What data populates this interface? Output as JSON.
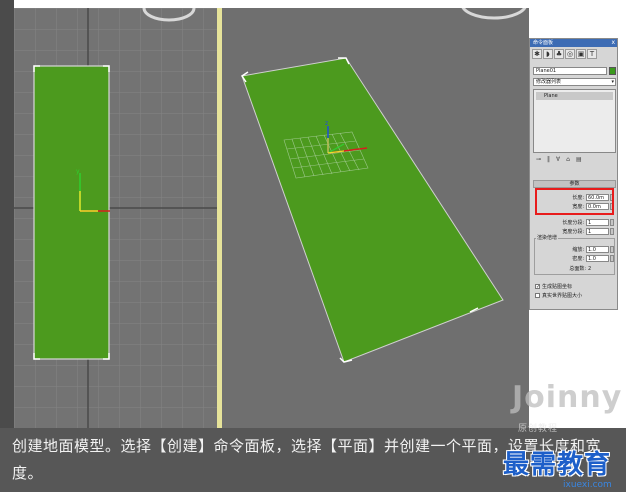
{
  "caption": {
    "text": "创建地面模型。选择【创建】命令面板，选择【平面】并创建一个平面，设置长度和宽度。"
  },
  "command_panel": {
    "title": "命令面板",
    "close_glyph": "x",
    "tabs": [
      "create-icon",
      "modify-icon",
      "hierarchy-icon",
      "motion-icon",
      "display-icon",
      "utilities-icon"
    ],
    "object_name": "Plane01",
    "modifier_list": "修改器列表",
    "stack_item": "Plane",
    "params_title": "参数",
    "length_label": "长度:",
    "length_value": "60.0m",
    "width_label": "宽度:",
    "width_value": "0.0m",
    "length_segs_label": "长度分段:",
    "length_segs_value": "1",
    "width_segs_label": "宽度分段:",
    "width_segs_value": "1",
    "render_group_label": "渲染倍增",
    "scale_label": "缩放:",
    "scale_value": "1.0",
    "density_label": "密度:",
    "density_value": "1.0",
    "total_faces_label": "总面数:",
    "total_faces_value": "2",
    "gen_map_label": "生成贴图坐标",
    "real_world_label": "真实世界贴图大小",
    "gen_map_checked": true,
    "real_world_checked": false
  },
  "watermarks": {
    "jointy": "Joinny",
    "sub": "原创教程",
    "brand": "最需教育",
    "site": "ixuexi.com"
  },
  "colors": {
    "plane_green": "#4c9a1e",
    "plane_green_dark": "#3f8a18",
    "viewport_bg": "#737373",
    "highlight": "#e81c1c",
    "gizmo_blue": "#1f4fd6",
    "gizmo_red": "#d61f1f",
    "gizmo_green": "#2fd02f"
  }
}
